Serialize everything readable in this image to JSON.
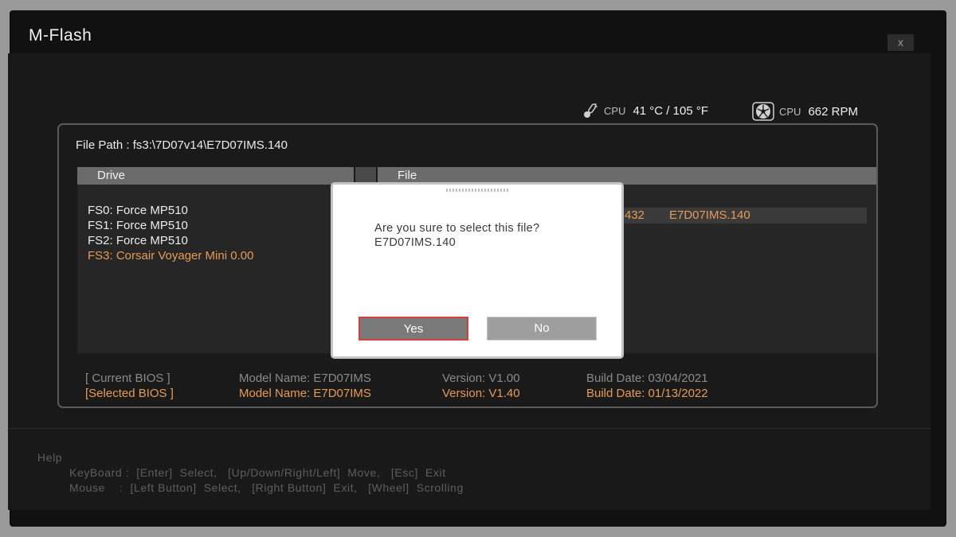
{
  "app": {
    "title": "M-Flash",
    "close_label": "x"
  },
  "sensors": {
    "cpu_temp": {
      "label": "CPU",
      "value": "41 °C / 105 °F",
      "icon": "thermometer-icon"
    },
    "cpu_fan": {
      "label": "CPU",
      "value": "662 RPM",
      "icon": "fan-icon"
    }
  },
  "file_path": {
    "text": "File Path : fs3:\\7D07v14\\E7D07IMS.140"
  },
  "drive_pane": {
    "header": "Drive",
    "items": [
      {
        "label": "FS0: Force MP510",
        "selected": false
      },
      {
        "label": "FS1: Force MP510",
        "selected": false
      },
      {
        "label": "FS2: Force MP510",
        "selected": false
      },
      {
        "label": "FS3: Corsair Voyager Mini 0.00",
        "selected": true
      }
    ]
  },
  "file_pane": {
    "header": "File",
    "selected_row": {
      "size": "432",
      "name": "E7D07IMS.140"
    }
  },
  "bios": {
    "current": {
      "label": "[ Current BIOS  ]",
      "model": "Model Name: E7D07IMS",
      "version": "Version: V1.00",
      "build": "Build Date: 03/04/2021"
    },
    "selected": {
      "label": "[Selected BIOS ]",
      "model": "Model Name: E7D07IMS",
      "version": "Version: V1.40",
      "build": "Build Date: 01/13/2022"
    }
  },
  "help": {
    "title": "Help",
    "keyboard": "KeyBoard :  [Enter]  Select,   [Up/Down/Right/Left]  Move,   [Esc]  Exit",
    "mouse": "Mouse    :  [Left Button]  Select,   [Right Button]  Exit,   [Wheel]  Scrolling"
  },
  "dialog": {
    "question": "Are you sure to select this file?",
    "filename": "E7D07IMS.140",
    "yes_label": "Yes",
    "no_label": "No"
  },
  "colors": {
    "accent": "#e89a55",
    "highlight_border": "#d44040",
    "background": "#111111"
  }
}
